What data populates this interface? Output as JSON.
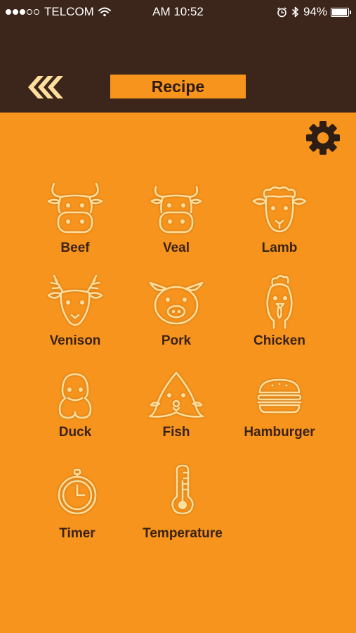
{
  "status_bar": {
    "carrier": "TELCOM",
    "time": "AM 10:52",
    "battery": "94%",
    "battery_level": 0.94,
    "signal_bars_filled": 3,
    "signal_bars_total": 5
  },
  "header": {
    "title": "Recipe",
    "back_icon": "double-chevron-left-icon",
    "settings_icon": "gear-icon"
  },
  "colors": {
    "background": "#f7941d",
    "header_background": "#3c251a",
    "icon": "#ffdf9e",
    "label": "#3a2216"
  },
  "menu": {
    "items": [
      {
        "label": "Beef",
        "icon": "cow-icon"
      },
      {
        "label": "Veal",
        "icon": "calf-icon"
      },
      {
        "label": "Lamb",
        "icon": "sheep-icon"
      },
      {
        "label": "Venison",
        "icon": "deer-icon"
      },
      {
        "label": "Pork",
        "icon": "pig-icon"
      },
      {
        "label": "Chicken",
        "icon": "chicken-icon"
      },
      {
        "label": "Duck",
        "icon": "duck-icon"
      },
      {
        "label": "Fish",
        "icon": "fish-icon"
      },
      {
        "label": "Hamburger",
        "icon": "hamburger-icon"
      },
      {
        "label": "Timer",
        "icon": "stopwatch-icon"
      },
      {
        "label": "Temperature",
        "icon": "thermometer-icon"
      }
    ]
  }
}
